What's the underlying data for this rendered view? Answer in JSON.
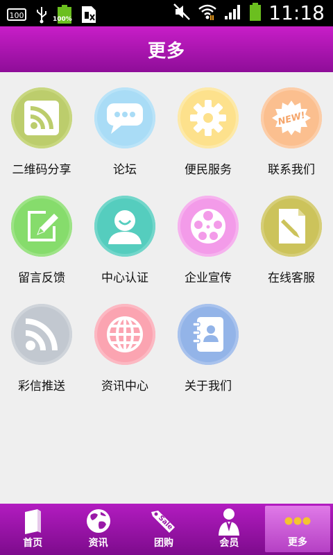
{
  "status_bar": {
    "time": "11:18",
    "battery_small_text": "100%",
    "box_text": "100",
    "icons": [
      "battery-100-icon",
      "usb-icon",
      "battery-full-icon",
      "sim-icon",
      "mute-icon",
      "wifi-icon",
      "signal-icon",
      "battery-icon"
    ]
  },
  "header": {
    "title": "更多"
  },
  "grid": {
    "items": [
      {
        "label": "二维码分享",
        "icon": "rss-square-icon",
        "color": "#b9cd6a"
      },
      {
        "label": "论坛",
        "icon": "chat-bubble-icon",
        "color": "#a9dcf5"
      },
      {
        "label": "便民服务",
        "icon": "gear-icon",
        "color": "#fbe08b"
      },
      {
        "label": "联系我们",
        "icon": "new-badge-icon",
        "color": "#fbbf8e"
      },
      {
        "label": "留言反馈",
        "icon": "edit-note-icon",
        "color": "#86dd6b"
      },
      {
        "label": "中心认证",
        "icon": "user-icon",
        "color": "#57cfc0"
      },
      {
        "label": "企业宣传",
        "icon": "film-reel-icon",
        "color": "#f49be8"
      },
      {
        "label": "在线客服",
        "icon": "document-pencil-icon",
        "color": "#cbc35a"
      },
      {
        "label": "彩信推送",
        "icon": "rss-icon",
        "color": "#c2c8cf"
      },
      {
        "label": "资讯中心",
        "icon": "globe-icon",
        "color": "#fba4b1"
      },
      {
        "label": "关于我们",
        "icon": "contact-book-icon",
        "color": "#93b5e8"
      }
    ]
  },
  "new_badge_text": "NEW!",
  "tab_bar": {
    "tabs": [
      {
        "label": "首页",
        "icon": "book-icon",
        "active": false
      },
      {
        "label": "资讯",
        "icon": "globe-icon",
        "active": false
      },
      {
        "label": "团购",
        "icon": "sale-tag-icon",
        "active": false
      },
      {
        "label": "会员",
        "icon": "member-icon",
        "active": false
      },
      {
        "label": "更多",
        "icon": "more-dots-icon",
        "active": true
      }
    ],
    "sale_text": "Sale"
  }
}
